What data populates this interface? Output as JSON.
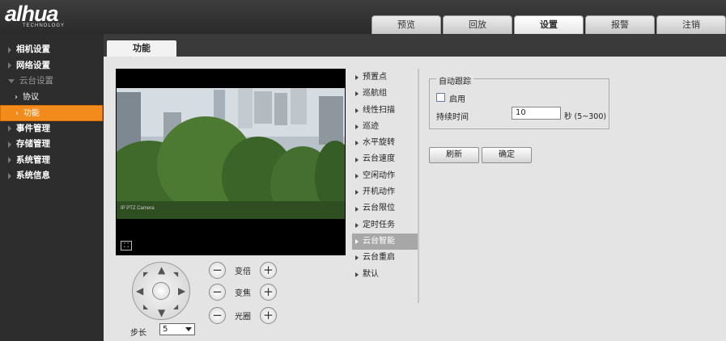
{
  "brand": {
    "logo_text": "alhua",
    "logo_sub": "TECHNOLOGY"
  },
  "topnav": [
    "预览",
    "回放",
    "设置",
    "报警",
    "注销"
  ],
  "sidebar": {
    "items": [
      {
        "label": "相机设置"
      },
      {
        "label": "网络设置"
      },
      {
        "label": "云台设置"
      },
      {
        "label": "协议"
      },
      {
        "label": "功能"
      },
      {
        "label": "事件管理"
      },
      {
        "label": "存储管理"
      },
      {
        "label": "系统管理"
      },
      {
        "label": "系统信息"
      }
    ]
  },
  "page_tab": "功能",
  "video": {
    "camera_label": "IP PTZ Camera"
  },
  "ptz": {
    "zoom_label": "变倍",
    "focus_label": "变焦",
    "iris_label": "光圈",
    "step_label": "步长",
    "step_value": "5"
  },
  "function_menu": [
    "预置点",
    "巡航组",
    "线性扫描",
    "巡迹",
    "水平旋转",
    "云台速度",
    "空闲动作",
    "开机动作",
    "云台限位",
    "定时任务",
    "云台智能",
    "云台重启",
    "默认"
  ],
  "auto_track": {
    "legend": "自动跟踪",
    "enable_label": "启用",
    "enabled": false,
    "duration_label": "持续时间",
    "duration_value": "10",
    "duration_unit": "秒 (5~300)"
  },
  "buttons": {
    "refresh": "刷新",
    "confirm": "确定"
  },
  "colors": {
    "accent": "#f28b1c",
    "menu_active": "#a7a7a7",
    "header": "#2d2d2d"
  }
}
